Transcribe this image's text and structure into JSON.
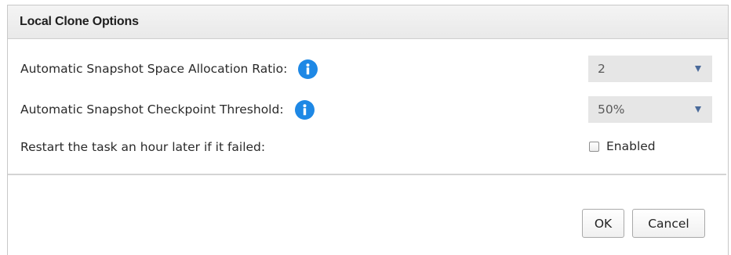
{
  "dialog": {
    "title": "Local Clone Options"
  },
  "options": {
    "space_ratio": {
      "label": "Automatic Snapshot Space Allocation Ratio:",
      "value": "2",
      "info_icon": "info-icon"
    },
    "checkpoint_threshold": {
      "label": "Automatic Snapshot Checkpoint Threshold:",
      "value": "50%",
      "info_icon": "info-icon"
    },
    "restart_task": {
      "label": "Restart the task an hour later if it failed:",
      "checkbox_label": "Enabled",
      "checked": false
    }
  },
  "buttons": {
    "ok_label": "OK",
    "cancel_label": "Cancel"
  },
  "colors": {
    "info_icon": "#1e88e5",
    "select_bg": "#e6e6e6",
    "caret": "#4a6a9a"
  }
}
